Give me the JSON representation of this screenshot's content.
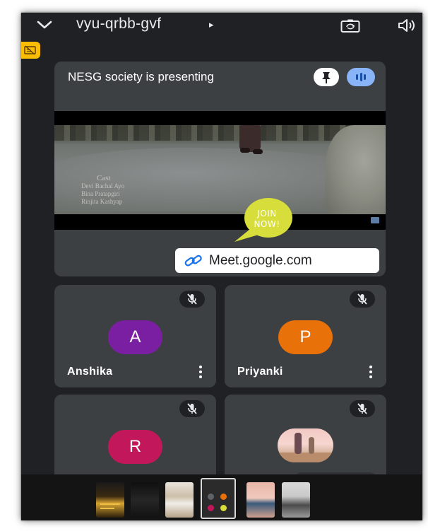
{
  "header": {
    "meeting_code": "vyu-qrbb-gvf",
    "caret": "▸"
  },
  "presentation": {
    "title": "NESG society is presenting",
    "video_overlay": {
      "heading": "Cast",
      "lines": [
        "Devi Bachal Ayo",
        "Bina Pratapgiri",
        "Rinjita Kashyap"
      ]
    },
    "join_bubble": {
      "line1": "JOIN",
      "line2": "NOW!"
    },
    "url": "Meet.google.com"
  },
  "participants": [
    {
      "initial": "A",
      "name": "Anshika",
      "color": "#7b1fa2",
      "muted": true
    },
    {
      "initial": "P",
      "name": "Priyanki",
      "color": "#e8710a",
      "muted": true
    },
    {
      "initial": "R",
      "name": "",
      "color": "#c2185b",
      "muted": true
    },
    {
      "initial": "",
      "name": "",
      "color": "",
      "muted": true,
      "avatar": "photo"
    }
  ],
  "colors": {
    "background": "#202124",
    "tile": "#3c4043",
    "audio_pill": "#8ab4f8",
    "side_badge": "#fbbc04",
    "link_icon": "#1a73e8",
    "join_bubble": "#d7dd3a"
  },
  "icons": [
    "chevron-down-icon",
    "camera-switch-icon",
    "speaker-icon",
    "presentation-off-icon",
    "pin-icon",
    "audio-level-icon",
    "link-icon",
    "mic-off-icon",
    "more-vert-icon"
  ]
}
